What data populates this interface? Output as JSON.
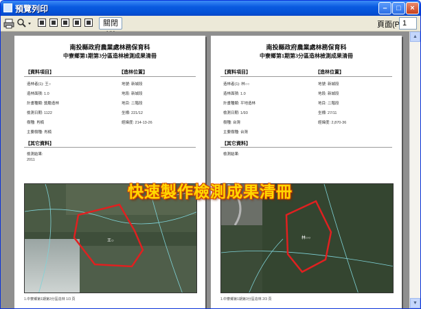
{
  "window": {
    "title": "預覽列印"
  },
  "toolbar": {
    "print_icon": "printer-icon",
    "zoom_icon": "magnifier-icon",
    "page_views": [
      "one-page",
      "two-pages",
      "three-pages",
      "four-pages",
      "six-pages"
    ],
    "close_label": "關閉(C)",
    "page_label": "頁面(P)",
    "page_value": "1"
  },
  "pages": [
    {
      "title": "南投縣政府農業處林務保育科",
      "subtitle": "中寮鄉第1期第3分區造林檢測成果清冊",
      "sections": {
        "basic": "【資料項目】",
        "location": "【造林位置】",
        "other": "【其它資料】"
      },
      "fields_left": [
        "造林者(1): 王○",
        "造林面積: 1.0",
        "計畫種類: 獎勵造林",
        "檢測日期: 1122",
        "樹種: 肖楠",
        "主要樹種: 肖楠"
      ],
      "fields_right": [
        "地號: 新城段",
        "地段: 新城段",
        "地目: 二階段",
        "坐標: 221/12",
        "經緯度: 214-13-26"
      ],
      "other_text": [
        "檢測結果:",
        "2011"
      ],
      "polygon_label": "王○",
      "footer": "1.中寮鄉第1期第3分區造林 1/3 頁"
    },
    {
      "title": "南投縣政府農業處林務保育科",
      "subtitle": "中寮鄉第1期第3分區造林檢測成果清冊",
      "sections": {
        "basic": "【資料項目】",
        "location": "【造林位置】",
        "other": "【其它資料】"
      },
      "fields_left": [
        "造林者(1): 林○○",
        "造林面積: 1.0",
        "計畫種類: 平地造林",
        "檢測日期: 1/93",
        "樹種: 台灣",
        "主要樹種: 台灣"
      ],
      "fields_right": [
        "地號: 新城段",
        "地段: 新城段",
        "地目: 二階段",
        "坐標: 27/11",
        "經緯度: 2,870-36"
      ],
      "other_text": [
        "檢測結果:"
      ],
      "polygon_label": "林○○",
      "footer": "1.中寮鄉第1期第3分區造林 2/3 頁"
    }
  ],
  "overlay_caption": "快速製作檢測成果清冊",
  "colors": {
    "titlebar": "#0a5be0",
    "polygon": "#e02020",
    "overlay": "#ffd800"
  }
}
